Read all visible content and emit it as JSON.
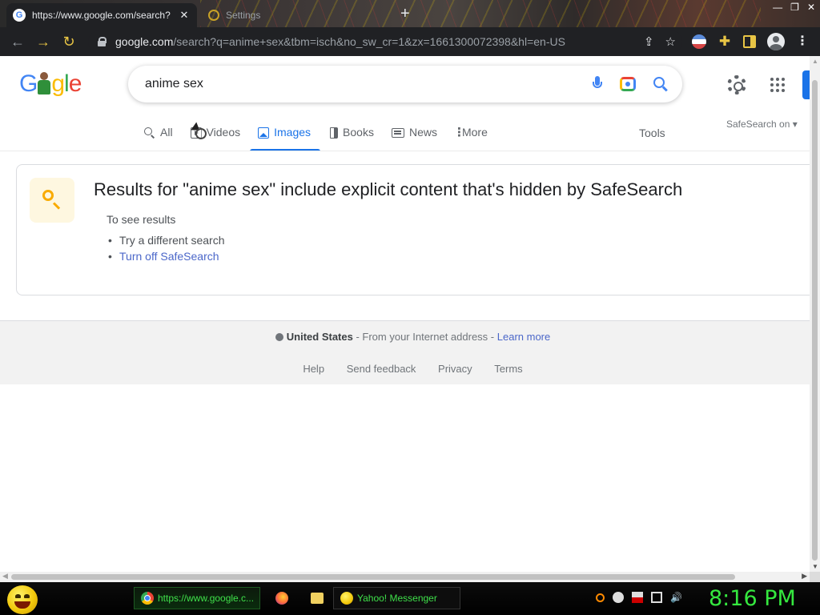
{
  "browser": {
    "active_tab": {
      "title": "https://www.google.com/search?",
      "favicon": "google-favicon-icon"
    },
    "inactive_tab": {
      "title": "Settings"
    },
    "newtab_symbol": "+",
    "url_host": "google.com",
    "url_path": "/search?q=anime+sex&tbm=isch&no_sw_cr=1&zx=1661300072398&hl=en-US"
  },
  "google": {
    "logo": {
      "g1": "G",
      "o1": "o",
      "o2": "g",
      "l": "l",
      "e": "e"
    },
    "query": "anime sex",
    "tabs": [
      {
        "label": "All",
        "icon": "search-icon"
      },
      {
        "label": "Videos",
        "icon": "play-icon"
      },
      {
        "label": "Images",
        "icon": "image-icon",
        "active": true
      },
      {
        "label": "Books",
        "icon": "book-icon"
      },
      {
        "label": "News",
        "icon": "news-icon"
      },
      {
        "label": "More",
        "icon": "more-dots-icon"
      }
    ],
    "tools_label": "Tools",
    "safesearch_label": "SafeSearch on ▾"
  },
  "notice": {
    "heading": "Results for \"anime sex\" include explicit content that's hidden by SafeSearch",
    "see_results": "To see results",
    "items": [
      {
        "label": "Try a different search"
      },
      {
        "label": "Turn off SafeSearch"
      }
    ]
  },
  "footer": {
    "country": "United States",
    "location_text": " - From your Internet address - ",
    "learn_more": "Learn more",
    "links": [
      "Help",
      "Send feedback",
      "Privacy",
      "Terms"
    ]
  },
  "taskbar": {
    "chrome_task": "https://www.google.c...",
    "yahoo_task": "Yahoo! Messenger",
    "clock": "8:16 PM"
  },
  "colors": {
    "accent_blue": "#1a73e8",
    "link_blue": "#4b67c9",
    "clock_green": "#35e83f"
  }
}
